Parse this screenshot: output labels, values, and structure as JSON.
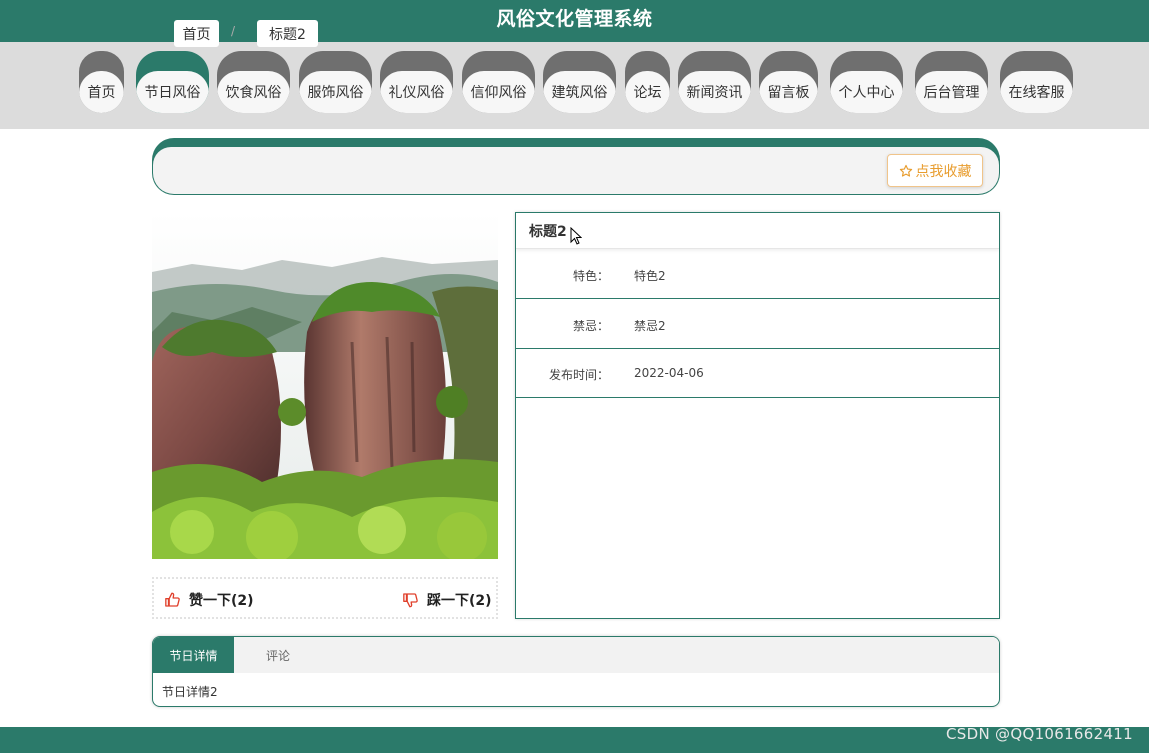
{
  "header": {
    "title": "风俗文化管理系统"
  },
  "nav": {
    "items": [
      {
        "label": "首页",
        "active": false
      },
      {
        "label": "节日风俗",
        "active": true
      },
      {
        "label": "饮食风俗",
        "active": false
      },
      {
        "label": "服饰风俗",
        "active": false
      },
      {
        "label": "礼仪风俗",
        "active": false
      },
      {
        "label": "信仰风俗",
        "active": false
      },
      {
        "label": "建筑风俗",
        "active": false
      },
      {
        "label": "论坛",
        "active": false
      },
      {
        "label": "新闻资讯",
        "active": false
      },
      {
        "label": "留言板",
        "active": false
      },
      {
        "label": "个人中心",
        "active": false
      },
      {
        "label": "后台管理",
        "active": false
      },
      {
        "label": "在线客服",
        "active": false
      }
    ]
  },
  "breadcrumb": {
    "home": "首页",
    "separator": "/",
    "current": "标题2"
  },
  "favorite": {
    "icon": "star-outline-icon",
    "label": "点我收藏"
  },
  "votes": {
    "like_label": "赞一下(2)",
    "like_icon": "thumbs-up-icon",
    "dislike_label": "踩一下(2)",
    "dislike_icon": "thumbs-down-icon"
  },
  "detail": {
    "title": "标题2",
    "fields": [
      {
        "key": "特色：",
        "value": "特色2"
      },
      {
        "key": "禁忌：",
        "value": "禁忌2"
      },
      {
        "key": "发布时间：",
        "value": "2022-04-06"
      }
    ]
  },
  "tabs": {
    "items": [
      {
        "label": "节日详情",
        "active": true
      },
      {
        "label": "评论",
        "active": false
      }
    ],
    "content": "节日详情2"
  },
  "watermark": "CSDN @QQ1061662411",
  "colors": {
    "primary": "#2b7a6a",
    "nav_inactive": "#6f6f6f",
    "accent": "#e89d2f",
    "vote_icon": "#e0402c"
  }
}
